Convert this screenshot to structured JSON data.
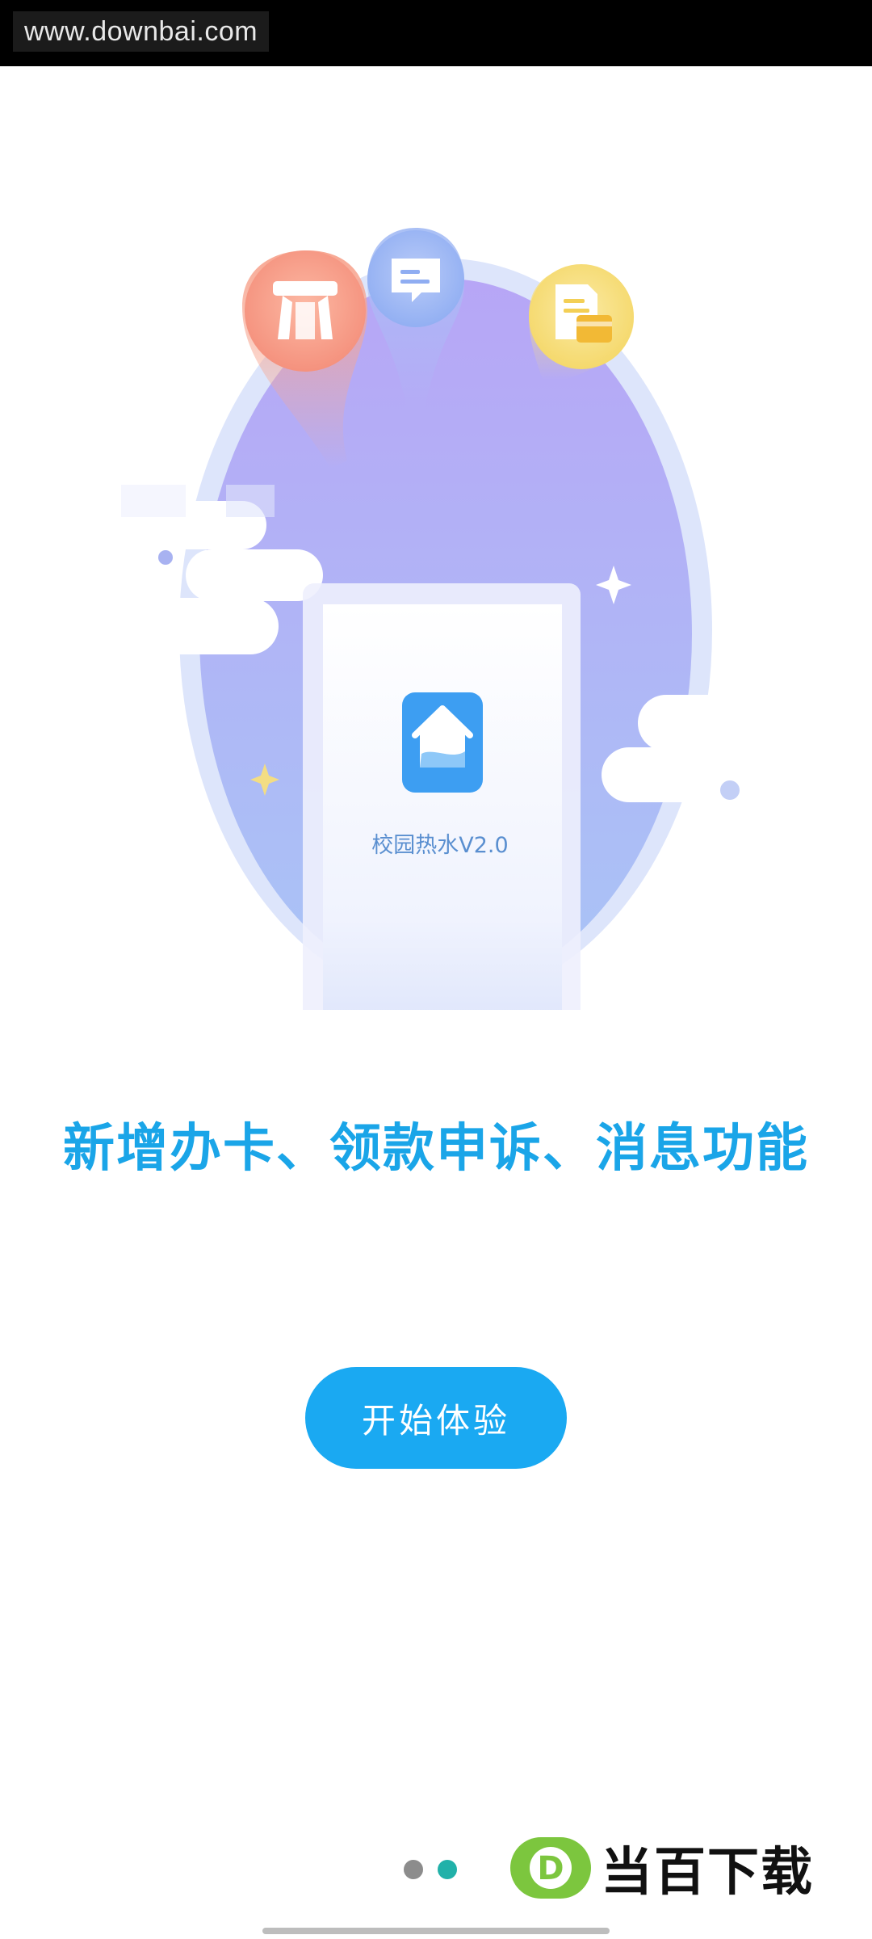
{
  "watermark": {
    "top_text": "www.downbai.com",
    "brand_text": "当百下载",
    "brand_badge": "D"
  },
  "illustration": {
    "app_icon": "house-icon",
    "app_label": "校园热水V2.0",
    "bubbles": [
      "card-icon",
      "message-icon",
      "document-card-icon"
    ],
    "colors": {
      "globe": "#a6b2f5",
      "globe_ring": "#dbe4fb",
      "bubble_red": "#f6927e",
      "bubble_blue": "#8cacf3",
      "bubble_yellow": "#f5dc6c",
      "app_icon": "#3d9ef2"
    }
  },
  "headline": "新增办卡、领款申诉、消息功能",
  "start_button": {
    "label": "开始体验",
    "color": "#1aa9f2"
  },
  "pager": {
    "total": 2,
    "current": 2,
    "active_color": "#21b1a9"
  }
}
